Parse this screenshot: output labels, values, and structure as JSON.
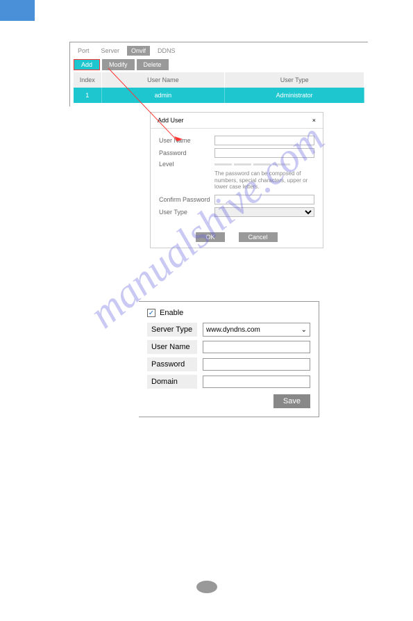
{
  "watermark": "manualshive.com",
  "tabs": {
    "items": [
      "Port",
      "Server",
      "Onvif",
      "DDNS"
    ],
    "active_index": 2
  },
  "action_buttons": {
    "add": "Add",
    "modify": "Modify",
    "delete": "Delete"
  },
  "user_table": {
    "headers": {
      "index": "Index",
      "username": "User Name",
      "usertype": "User Type"
    },
    "rows": [
      {
        "index": "1",
        "username": "admin",
        "usertype": "Administrator"
      }
    ]
  },
  "dialog": {
    "title": "Add User",
    "close": "×",
    "fields": {
      "username": "User Name",
      "password": "Password",
      "level": "Level",
      "confirm": "Confirm Password",
      "usertype": "User Type"
    },
    "hint": "The password can be composed of numbers, special characters, upper or lower case letters.",
    "ok": "OK",
    "cancel": "Cancel"
  },
  "ddns_form": {
    "enable": "Enable",
    "server_type": "Server Type",
    "server_type_value": "www.dyndns.com",
    "username": "User Name",
    "password": "Password",
    "domain": "Domain",
    "save": "Save"
  }
}
